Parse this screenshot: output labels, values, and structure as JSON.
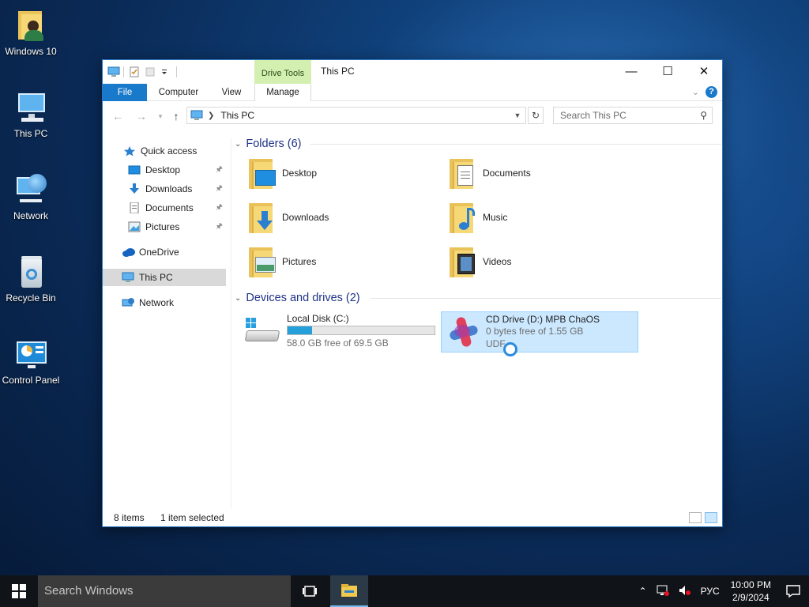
{
  "desktop": {
    "icons": [
      {
        "label": "Windows 10",
        "icon": "user-folder-icon"
      },
      {
        "label": "This PC",
        "icon": "computer-icon"
      },
      {
        "label": "Network",
        "icon": "network-globe-icon"
      },
      {
        "label": "Recycle Bin",
        "icon": "recycle-bin-icon"
      },
      {
        "label": "Control Panel",
        "icon": "control-panel-icon"
      }
    ]
  },
  "window": {
    "title": "This PC",
    "contextual_tab_group": "Drive Tools",
    "tabs": {
      "file": "File",
      "computer": "Computer",
      "view": "View",
      "manage": "Manage"
    },
    "controls": {
      "minimize": "—",
      "maximize": "☐",
      "close": "✕"
    },
    "address": {
      "crumb": "This PC"
    },
    "search": {
      "placeholder": "Search This PC"
    }
  },
  "navpane": {
    "items": [
      {
        "label": "Quick access",
        "icon": "star-icon"
      },
      {
        "label": "Desktop",
        "icon": "desktop-icon",
        "pinned": true
      },
      {
        "label": "Downloads",
        "icon": "download-arrow-icon",
        "pinned": true
      },
      {
        "label": "Documents",
        "icon": "document-icon",
        "pinned": true
      },
      {
        "label": "Pictures",
        "icon": "pictures-icon",
        "pinned": true
      },
      {
        "label": "OneDrive",
        "icon": "cloud-icon"
      },
      {
        "label": "This PC",
        "icon": "computer-icon",
        "selected": true
      },
      {
        "label": "Network",
        "icon": "network-icon"
      }
    ]
  },
  "content": {
    "folders_header": "Folders (6)",
    "folders": [
      {
        "label": "Desktop",
        "icon": "desktop-folder-icon"
      },
      {
        "label": "Documents",
        "icon": "documents-folder-icon"
      },
      {
        "label": "Downloads",
        "icon": "downloads-folder-icon"
      },
      {
        "label": "Music",
        "icon": "music-folder-icon"
      },
      {
        "label": "Pictures",
        "icon": "pictures-folder-icon"
      },
      {
        "label": "Videos",
        "icon": "videos-folder-icon"
      }
    ],
    "drives_header": "Devices and drives (2)",
    "drives": [
      {
        "name": "Local Disk (C:)",
        "usage": "58.0 GB free of 69.5 GB",
        "used_fraction": 0.165,
        "icon": "hard-disk-icon"
      },
      {
        "name": "CD Drive (D:) MPB ChaOS",
        "usage": "0 bytes free of 1.55 GB",
        "filesystem": "UDF",
        "icon": "cd-drive-icon",
        "selected": true
      }
    ]
  },
  "status": {
    "items": "8 items",
    "selected": "1 item selected"
  },
  "taskbar": {
    "search_placeholder": "Search Windows",
    "tray": {
      "language": "РУС",
      "time": "10:00 PM",
      "date": "2/9/2024"
    }
  },
  "colors": {
    "accent": "#1979ca",
    "drive_tools": "#d3f0b0",
    "selection": "#cce8ff",
    "progress": "#26a0da"
  }
}
